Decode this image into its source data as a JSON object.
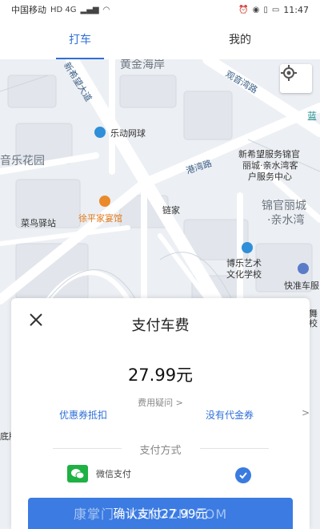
{
  "status_bar": {
    "carrier": "中国移动",
    "network_badges": "HD 4G",
    "time": "11:47"
  },
  "tabs": [
    {
      "label": "打车",
      "active": true
    },
    {
      "label": "我的",
      "active": false
    }
  ],
  "map": {
    "labels": {
      "huangjin": "黄金海岸",
      "guanjing": "观音湾路",
      "xinxiwang": "新希望大道",
      "landun": "蓝",
      "ledong": "乐动网球",
      "lehua": "音乐花园",
      "service_center": [
        "新希望服务锦官",
        "丽城·亲水湾客",
        "户服务中心"
      ],
      "gangwan": "港湾路",
      "lianjia": "链家",
      "jinguan": [
        "锦官丽城",
        "·亲水湾"
      ],
      "xuping": "徐平家宴馆",
      "cainiao": "菜鸟驿站",
      "bole": [
        "博乐艺术",
        "文化学校"
      ],
      "kuaizhun": "快准车服",
      "right_edge": "舞校",
      "left_edge": "底牌"
    },
    "locate_icon": "locate-icon"
  },
  "payment": {
    "title": "支付车费",
    "amount": "27.99元",
    "fee_question": "费用疑问 >",
    "coupon_left": "优惠券抵扣",
    "coupon_right": "没有代金券",
    "coupon_arrow": ">",
    "method_label": "支付方式",
    "wechat_label": "微信支付",
    "confirm_label": "确认支付27.99元"
  },
  "watermark": "康掌门 · KANGZM.COM",
  "colors": {
    "accent": "#2f6fd8",
    "button": "#3b7be2",
    "wechat": "#1fb143",
    "map_bg": "#eceff3"
  }
}
